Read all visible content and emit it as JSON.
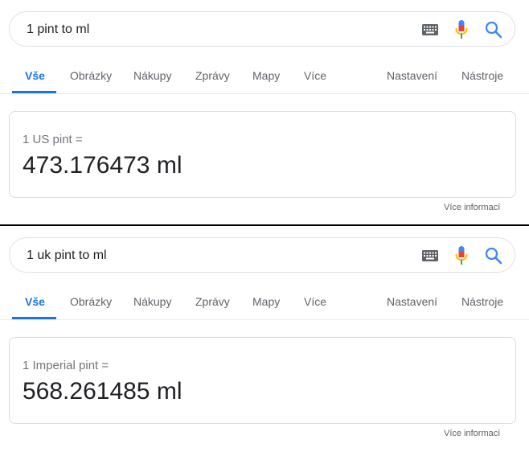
{
  "panels": [
    {
      "query": "1 pint to ml",
      "tabs": [
        "Vše",
        "Obrázky",
        "Nákupy",
        "Zprávy",
        "Mapy",
        "Více"
      ],
      "tools": [
        "Nastavení",
        "Nástroje"
      ],
      "result_from": "1 US pint =",
      "result_to": "473.176473 ml",
      "more_info": "Více informací"
    },
    {
      "query": "1 uk pint to ml",
      "tabs": [
        "Vše",
        "Obrázky",
        "Nákupy",
        "Zprávy",
        "Mapy",
        "Více"
      ],
      "tools": [
        "Nastavení",
        "Nástroje"
      ],
      "result_from": "1 Imperial pint =",
      "result_to": "568.261485 ml",
      "more_info": "Více informací"
    }
  ],
  "icons": {
    "keyboard": "keyboard-icon",
    "mic": "mic-icon",
    "search": "search-icon"
  },
  "colors": {
    "accent": "#1a73e8",
    "text": "#202124",
    "muted": "#70757a",
    "mic_blue": "#4285f4",
    "mic_red": "#ea4335",
    "mic_yellow": "#fbbc04",
    "mic_green": "#34a853"
  }
}
